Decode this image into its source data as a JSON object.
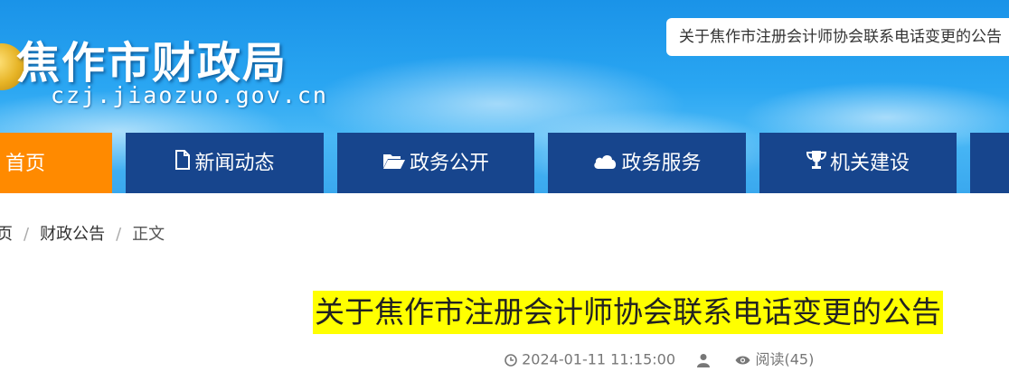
{
  "site": {
    "title": "焦作市财政局",
    "domain": "czj.jiaozuo.gov.cn"
  },
  "search": {
    "value": "关于焦作市注册会计师协会联系电话变更的公告"
  },
  "nav": {
    "items": [
      {
        "label": "首页",
        "icon": "none"
      },
      {
        "label": "新闻动态",
        "icon": "file-icon"
      },
      {
        "label": "政务公开",
        "icon": "folder-open-icon"
      },
      {
        "label": "政务服务",
        "icon": "cloud-icon"
      },
      {
        "label": "机关建设",
        "icon": "trophy-icon"
      }
    ]
  },
  "breadcrumb": {
    "items": [
      "页",
      "财政公告",
      "正文"
    ],
    "separator": "/"
  },
  "article": {
    "title": "关于焦作市注册会计师协会联系电话变更的公告",
    "datetime": "2024-01-11 11:15:00",
    "reads": "阅读(45)"
  },
  "colors": {
    "header_blue": "#2aa6f2",
    "nav_blue": "#17458d",
    "nav_active": "#ff8a00",
    "title_highlight": "#ffff00"
  }
}
